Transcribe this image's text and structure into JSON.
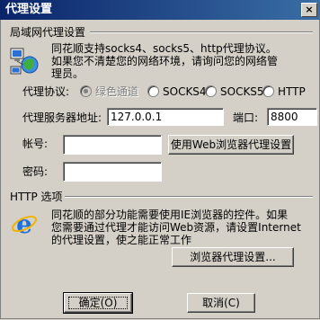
{
  "window": {
    "title": "代理设置",
    "close_label": "×"
  },
  "lan": {
    "group_label": "局域网代理设置",
    "description_line1": "同花顺支持socks4、socks5、http代理协议。",
    "description_line2": "如果您不清楚您的网络环境，请询问您的网络管",
    "description_line3": "理员。",
    "protocol_label": "代理协议:",
    "protocol_options": [
      "绿色通道",
      "SOCKS4",
      "SOCKS5",
      "HTTP"
    ],
    "selected_protocol": "绿色通道",
    "server_label": "代理服务器地址:",
    "server_value": "127.0.0.1",
    "port_label": "端口:",
    "port_value": "8800",
    "account_label": "帐号:",
    "account_value": "",
    "password_label": "密码:",
    "password_value": "",
    "use_web_proxy_button": "使用Web浏览器代理设置"
  },
  "http": {
    "group_label": "HTTP 选项",
    "description_line1": "同花顺的部分功能需要使用IE浏览器的控件。如果",
    "description_line2": "您需要通过代理才能访问Web资源，请设置Internet",
    "description_line3": "的代理设置，使之能正常工作",
    "browser_proxy_button": "浏览器代理设置..."
  },
  "footer": {
    "ok_label": "确定(O)",
    "cancel_label": "取消(C)"
  }
}
